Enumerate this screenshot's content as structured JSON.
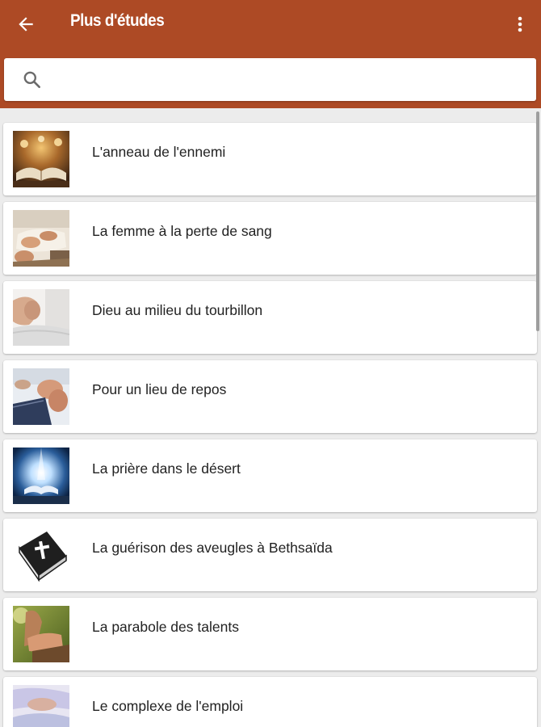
{
  "header": {
    "title": "Plus d'études",
    "background_color": "#ad4a25",
    "back_icon": "arrow-back-icon",
    "menu_icon": "more-vert-icon"
  },
  "search": {
    "placeholder": "",
    "value": "",
    "icon": "search-icon"
  },
  "studies": [
    {
      "label": "L'anneau de l'ennemi",
      "thumbnail": "open-bible-candles"
    },
    {
      "label": "La femme à la perte de sang",
      "thumbnail": "hands-on-bible"
    },
    {
      "label": "Dieu au milieu du tourbillon",
      "thumbnail": "folded-hands"
    },
    {
      "label": "Pour un lieu de repos",
      "thumbnail": "praying-hands-bible"
    },
    {
      "label": "La prière dans le désert",
      "thumbnail": "glowing-bible"
    },
    {
      "label": "La guérison des aveugles à Bethsaïda",
      "thumbnail": "black-bible-cross"
    },
    {
      "label": "La parabole des talents",
      "thumbnail": "person-praying-outdoors"
    },
    {
      "label": "Le complexe de l'emploi",
      "thumbnail": "hands-prayer-blue"
    }
  ]
}
